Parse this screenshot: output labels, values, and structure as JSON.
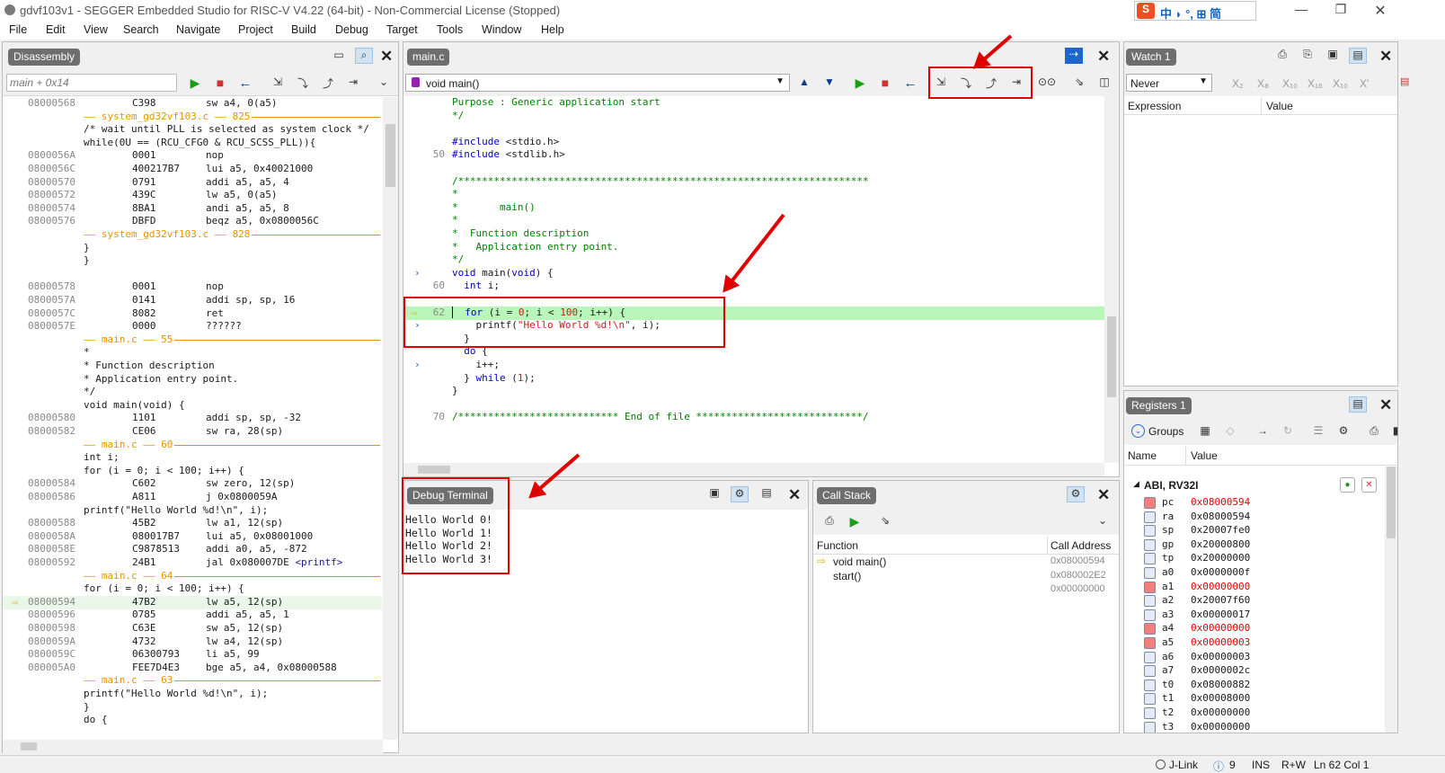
{
  "window": {
    "title": "gdvf103v1 - SEGGER Embedded Studio for RISC-V V4.22 (64-bit) - Non-Commercial License (Stopped)",
    "ime": "中 ◗ °, ⊞ 简"
  },
  "menu": [
    "File",
    "Edit",
    "View",
    "Search",
    "Navigate",
    "Project",
    "Build",
    "Debug",
    "Target",
    "Tools",
    "Window",
    "Help"
  ],
  "disasm": {
    "tab": "Disassembly",
    "location": "main + 0x14",
    "lines": [
      {
        "a": "08000568",
        "h": "C398",
        "i": "sw a4, 0(a5)",
        "k": "asm"
      },
      {
        "t": "—— system_gd32vf103.c —— 825",
        "k": "sep"
      },
      {
        "t": "/* wait until PLL is selected as system clock */",
        "k": "src"
      },
      {
        "t": "while(0U == (RCU_CFG0 & RCU_SCSS_PLL)){",
        "k": "src"
      },
      {
        "a": "0800056A",
        "h": "0001",
        "i": "nop",
        "k": "asm"
      },
      {
        "a": "0800056C",
        "h": "400217B7",
        "i": "lui a5, 0x40021000",
        "k": "asm"
      },
      {
        "a": "08000570",
        "h": "0791",
        "i": "addi a5, a5, 4",
        "k": "asm"
      },
      {
        "a": "08000572",
        "h": "439C",
        "i": "lw a5, 0(a5)",
        "k": "asm"
      },
      {
        "a": "08000574",
        "h": "8BA1",
        "i": "andi a5, a5, 8",
        "k": "asm"
      },
      {
        "a": "08000576",
        "h": "DBFD",
        "i": "beqz a5, 0x0800056C",
        "k": "asm"
      },
      {
        "t": "—— system_gd32vf103.c —— 828",
        "k": "sep"
      },
      {
        "t": "}",
        "k": "src"
      },
      {
        "t": "}",
        "k": "src"
      },
      {
        "t": "",
        "k": "src"
      },
      {
        "a": "08000578",
        "h": "0001",
        "i": "nop",
        "k": "asm"
      },
      {
        "a": "0800057A",
        "h": "0141",
        "i": "addi sp, sp, 16",
        "k": "asm"
      },
      {
        "a": "0800057C",
        "h": "8082",
        "i": "ret",
        "k": "asm"
      },
      {
        "a": "0800057E",
        "h": "0000",
        "i": "??????",
        "k": "asm"
      },
      {
        "t": "—— main.c —— 55",
        "k": "sep"
      },
      {
        "t": "*",
        "k": "src"
      },
      {
        "t": "* Function description",
        "k": "src"
      },
      {
        "t": "* Application entry point.",
        "k": "src"
      },
      {
        "t": "*/",
        "k": "src"
      },
      {
        "t": "void main(void) {",
        "k": "src"
      },
      {
        "a": "08000580",
        "h": "1101",
        "i": "addi sp, sp, -32",
        "k": "asm"
      },
      {
        "a": "08000582",
        "h": "CE06",
        "i": "sw ra, 28(sp)",
        "k": "asm"
      },
      {
        "t": "—— main.c —— 60",
        "k": "sep"
      },
      {
        "t": "int i;",
        "k": "src"
      },
      {
        "t": "for (i = 0; i < 100; i++) {",
        "k": "src"
      },
      {
        "a": "08000584",
        "h": "C602",
        "i": "sw zero, 12(sp)",
        "k": "asm"
      },
      {
        "a": "08000586",
        "h": "A811",
        "i": "j 0x0800059A",
        "k": "asm"
      },
      {
        "t": "printf(\"Hello World %d!\\n\", i);",
        "k": "src"
      },
      {
        "a": "08000588",
        "h": "45B2",
        "i": "lw a1, 12(sp)",
        "k": "asm"
      },
      {
        "a": "0800058A",
        "h": "080017B7",
        "i": "lui a5, 0x08001000",
        "k": "asm"
      },
      {
        "a": "0800058E",
        "h": "C9878513",
        "i": "addi a0, a5, -872",
        "k": "asm"
      },
      {
        "a": "08000592",
        "h": "24B1",
        "i": "jal 0x080007DE",
        "s": "<printf>",
        "k": "asm"
      },
      {
        "t": "—— main.c —— 64",
        "k": "sep"
      },
      {
        "t": "for (i = 0; i < 100; i++) {",
        "k": "src"
      },
      {
        "a": "08000594",
        "h": "47B2",
        "i": "lw a5, 12(sp)",
        "k": "asm",
        "cur": true
      },
      {
        "a": "08000596",
        "h": "0785",
        "i": "addi a5, a5, 1",
        "k": "asm"
      },
      {
        "a": "08000598",
        "h": "C63E",
        "i": "sw a5, 12(sp)",
        "k": "asm"
      },
      {
        "a": "0800059A",
        "h": "4732",
        "i": "lw a4, 12(sp)",
        "k": "asm"
      },
      {
        "a": "0800059C",
        "h": "06300793",
        "i": "li a5, 99",
        "k": "asm"
      },
      {
        "a": "080005A0",
        "h": "FEE7D4E3",
        "i": "bge a5, a4, 0x08000588",
        "k": "asm"
      },
      {
        "t": "—— main.c —— 63",
        "k": "sep"
      },
      {
        "t": "printf(\"Hello World %d!\\n\", i);",
        "k": "src"
      },
      {
        "t": "}",
        "k": "src"
      },
      {
        "t": "do {",
        "k": "src"
      }
    ]
  },
  "editor": {
    "tab": "main.c",
    "func": "void main()",
    "lines": [
      {
        "n": "",
        "t": "Purpose : Generic application start",
        "c": "green"
      },
      {
        "n": "",
        "t": "*/",
        "c": "green"
      },
      {
        "n": "",
        "t": "",
        "c": ""
      },
      {
        "n": "",
        "t": "#include <stdio.h>",
        "c": "inc"
      },
      {
        "n": "50",
        "t": "#include <stdlib.h>",
        "c": "inc"
      },
      {
        "n": "",
        "t": "",
        "c": ""
      },
      {
        "n": "",
        "t": "/*********************************************************************",
        "c": "green"
      },
      {
        "n": "",
        "t": "*",
        "c": "green"
      },
      {
        "n": "",
        "t": "*       main()",
        "c": "green"
      },
      {
        "n": "",
        "t": "*",
        "c": "green"
      },
      {
        "n": "",
        "t": "*  Function description",
        "c": "green"
      },
      {
        "n": "",
        "t": "*   Application entry point.",
        "c": "green"
      },
      {
        "n": "",
        "t": "*/",
        "c": "green"
      },
      {
        "n": "",
        "t": "void main(void) {",
        "c": "code",
        "m": "›"
      },
      {
        "n": "60",
        "t": "  int i;",
        "c": "code"
      },
      {
        "n": "",
        "t": "",
        "c": ""
      },
      {
        "n": "62",
        "t": "  for (i = 0; i < 100; i++) {",
        "c": "code",
        "cur": true
      },
      {
        "n": "",
        "t": "    printf(\"Hello World %d!\\n\", i);",
        "c": "code",
        "m": "›"
      },
      {
        "n": "",
        "t": "  }",
        "c": "code"
      },
      {
        "n": "",
        "t": "  do {",
        "c": "code"
      },
      {
        "n": "",
        "t": "    i++;",
        "c": "code",
        "m": "›"
      },
      {
        "n": "",
        "t": "  } while (1);",
        "c": "code"
      },
      {
        "n": "",
        "t": "}",
        "c": "code"
      },
      {
        "n": "",
        "t": "",
        "c": ""
      },
      {
        "n": "70",
        "t": "/*************************** End of file ****************************/",
        "c": "green"
      }
    ]
  },
  "watch": {
    "tab": "Watch 1",
    "refresh": "Never",
    "cols": [
      "Expression",
      "Value"
    ],
    "fmt": [
      "X₂",
      "X₈",
      "X₁₀",
      "X₁₆",
      "X₁₀",
      "X'"
    ]
  },
  "registers": {
    "tab": "Registers 1",
    "groups_label": "Groups",
    "cols": [
      "Name",
      "Value"
    ],
    "group": "ABI, RV32I",
    "regs": [
      {
        "n": "pc",
        "v": "0x08000594",
        "ch": true
      },
      {
        "n": "ra",
        "v": "0x08000594"
      },
      {
        "n": "sp",
        "v": "0x20007fe0"
      },
      {
        "n": "gp",
        "v": "0x20000800"
      },
      {
        "n": "tp",
        "v": "0x20000000"
      },
      {
        "n": "a0",
        "v": "0x0000000f"
      },
      {
        "n": "a1",
        "v": "0x00000000",
        "ch": true
      },
      {
        "n": "a2",
        "v": "0x20007f60"
      },
      {
        "n": "a3",
        "v": "0x00000017"
      },
      {
        "n": "a4",
        "v": "0x00000000",
        "ch": true
      },
      {
        "n": "a5",
        "v": "0x00000003",
        "ch": true
      },
      {
        "n": "a6",
        "v": "0x00000003"
      },
      {
        "n": "a7",
        "v": "0x0000002c"
      },
      {
        "n": "t0",
        "v": "0x08000882"
      },
      {
        "n": "t1",
        "v": "0x00008000"
      },
      {
        "n": "t2",
        "v": "0x00000000"
      },
      {
        "n": "t3",
        "v": "0x00000000"
      }
    ]
  },
  "terminal": {
    "tab": "Debug Terminal",
    "lines": [
      "Hello World 0!",
      "Hello World 1!",
      "Hello World 2!",
      "Hello World 3!"
    ]
  },
  "callstack": {
    "tab": "Call Stack",
    "cols": [
      "Function",
      "Call Address"
    ],
    "rows": [
      {
        "f": "void main()",
        "a": "0x08000594",
        "cur": true
      },
      {
        "f": "start()",
        "a": "0x080002E2"
      },
      {
        "f": "",
        "a": "0x00000000"
      }
    ]
  },
  "status": {
    "jlink": "J-Link",
    "errors": "9",
    "ins": "INS",
    "rw": "R+W",
    "pos": "Ln 62 Col 1"
  }
}
